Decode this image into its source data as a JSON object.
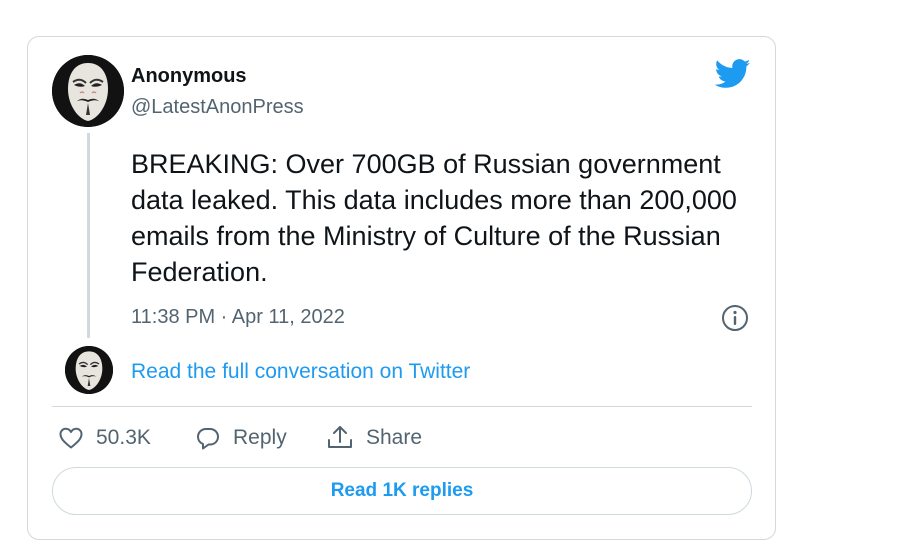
{
  "tweet": {
    "author_name": "Anonymous",
    "author_handle": "@LatestAnonPress",
    "text": "BREAKING: Over 700GB of Russian government data leaked. This data includes more than 200,000 emails from the Ministry of Culture of the Russian Federation.",
    "timestamp": "11:38 PM · Apr 11, 2022",
    "full_conversation_link": "Read the full conversation on Twitter",
    "likes_count": "50.3K",
    "reply_label": "Reply",
    "share_label": "Share",
    "read_replies_label": "Read 1K replies"
  },
  "icons": {
    "brand": "twitter-bird-icon",
    "info": "info-icon",
    "like": "heart-icon",
    "reply": "reply-bubble-icon",
    "share": "share-upload-icon"
  },
  "colors": {
    "accent": "#1d9bf0",
    "text_primary": "#0f1419",
    "text_secondary": "#536471",
    "border": "#cfd9de"
  }
}
